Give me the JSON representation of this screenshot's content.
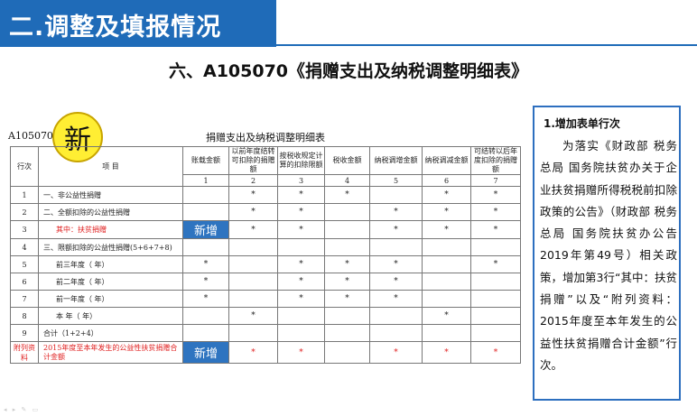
{
  "header": {
    "title": "二.调整及填报情况",
    "color": "#1f6bb8"
  },
  "slide_title": "六、A105070《捐赠支出及纳税调整明细表》",
  "form": {
    "code": "A105070",
    "name": "捐赠支出及纳税调整明细表",
    "new_marker": "新"
  },
  "table": {
    "headers": {
      "row_no": "行次",
      "item": "项 目",
      "columns": [
        "账载金额",
        "以前年度结转可扣除的捐赠额",
        "按税收规定计算的扣除限额",
        "税收金额",
        "纳税调增金额",
        "纳税调减金额",
        "可结转以后年度扣除的捐赠额"
      ],
      "col_numbers": [
        "1",
        "2",
        "3",
        "4",
        "5",
        "6",
        "7"
      ]
    },
    "rows": [
      {
        "no": "1",
        "item": "一、非公益性捐赠",
        "cells": [
          "",
          "*",
          "*",
          "*",
          "",
          "*",
          "*"
        ]
      },
      {
        "no": "2",
        "item": "二、全额扣除的公益性捐赠",
        "cells": [
          "",
          "*",
          "*",
          "",
          "*",
          "*",
          "*"
        ]
      },
      {
        "no": "3",
        "item": "其中：扶贫捐赠",
        "cells": [
          "新增",
          "*",
          "*",
          "",
          "*",
          "*",
          "*"
        ]
      },
      {
        "no": "4",
        "item": "三、限额扣除的公益性捐赠(5+6+7+8)",
        "cells": [
          "",
          "",
          "",
          "",
          "",
          "",
          ""
        ]
      },
      {
        "no": "5",
        "item": "前三年度（ 年）",
        "cells": [
          "*",
          "",
          "*",
          "*",
          "*",
          "",
          "*"
        ]
      },
      {
        "no": "6",
        "item": "前二年度（ 年）",
        "cells": [
          "*",
          "",
          "*",
          "*",
          "*",
          "",
          ""
        ]
      },
      {
        "no": "7",
        "item": "前一年度（ 年）",
        "cells": [
          "*",
          "",
          "*",
          "*",
          "*",
          "",
          ""
        ]
      },
      {
        "no": "8",
        "item": "本 年（ 年）",
        "cells": [
          "",
          "*",
          "",
          "",
          "",
          "*",
          ""
        ]
      },
      {
        "no": "9",
        "item": "合计（1+2+4）",
        "cells": [
          "",
          "",
          "",
          "",
          "",
          "",
          ""
        ]
      }
    ],
    "appendix": {
      "label": "附列资料",
      "item": "2015年度至本年发生的公益性扶贫捐赠合计金额",
      "cells": [
        "新增",
        "*",
        "*",
        "",
        "*",
        "*",
        "*"
      ]
    }
  },
  "sidebar": {
    "heading": "1.增加表单行次",
    "body": "为落实《财政部 税务总局 国务院扶贫办关于企业扶贫捐赠所得税税前扣除政策的公告》（财政部 税务总局 国务院扶贫办公告2019年第49号）相关政策，增加第3行“其中：扶贫捐赠”以及“附列资料：2015年度至本年发生的公益性扶贫捐赠合计金额”行次。"
  },
  "footer": {
    "icons": "◂ ▸ ✎ ▭"
  },
  "colors": {
    "accent": "#1f6bb8",
    "highlight": "#2e74c0",
    "circle": "#ffee33",
    "red_text": "#e02020"
  }
}
